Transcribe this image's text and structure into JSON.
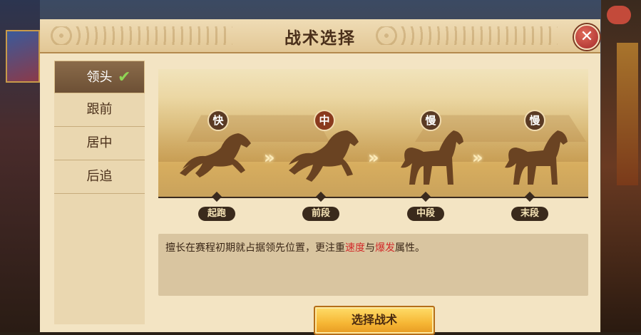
{
  "background": {
    "badge": ""
  },
  "dialog": {
    "title": "战术选择",
    "close_icon": "close-icon"
  },
  "tabs": [
    {
      "label": "领头",
      "active": true
    },
    {
      "label": "跟前",
      "active": false
    },
    {
      "label": "居中",
      "active": false
    },
    {
      "label": "后追",
      "active": false
    }
  ],
  "stages": [
    {
      "speed": "快",
      "label": "起跑"
    },
    {
      "speed": "中",
      "label": "前段"
    },
    {
      "speed": "慢",
      "label": "中段"
    },
    {
      "speed": "慢",
      "label": "末段"
    }
  ],
  "description": {
    "part1": "擅长在赛程初期就占据领先位置，更注重",
    "highlight1": "速度",
    "part2": "与",
    "highlight2": "爆发",
    "part3": "属性。"
  },
  "button": {
    "label": "选择战术"
  },
  "colors": {
    "accent": "#f6b735",
    "highlight": "#d22a2a",
    "check": "#8fd455"
  }
}
